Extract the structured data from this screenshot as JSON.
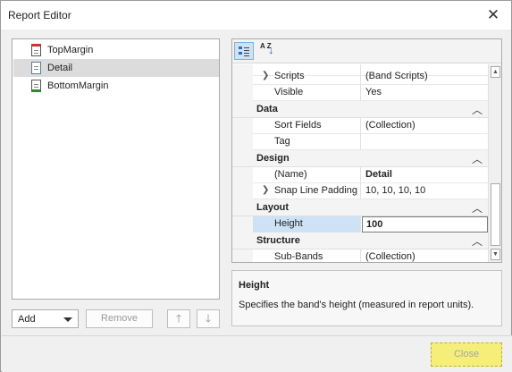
{
  "window": {
    "title": "Report Editor",
    "close_glyph": "✕"
  },
  "bands": [
    {
      "label": "TopMargin",
      "icon": "top-margin-band-icon"
    },
    {
      "label": "Detail",
      "icon": "detail-band-icon",
      "selected": true
    },
    {
      "label": "BottomMargin",
      "icon": "bottom-margin-band-icon"
    }
  ],
  "actions": {
    "add_label": "Add",
    "remove_label": "Remove",
    "up_glyph": "🡑",
    "down_glyph": "🡓"
  },
  "toolbar": {
    "categorized_icon": "categorized-icon",
    "alphabetical_icon": "sort-alphabetical-icon",
    "az_text": "A Z",
    "arrow_glyph": "↓"
  },
  "properties": {
    "rows": [
      {
        "kind": "prop",
        "name": "Scripts",
        "value": "(Band Scripts)",
        "expandable": true
      },
      {
        "kind": "prop",
        "name": "Visible",
        "value": "Yes"
      },
      {
        "kind": "cat",
        "name": "Data"
      },
      {
        "kind": "prop",
        "name": "Sort Fields",
        "value": "(Collection)"
      },
      {
        "kind": "prop",
        "name": "Tag",
        "value": ""
      },
      {
        "kind": "cat",
        "name": "Design"
      },
      {
        "kind": "prop",
        "name": "(Name)",
        "value": "Detail",
        "bold": true
      },
      {
        "kind": "prop",
        "name": "Snap Line Padding",
        "value": "10, 10, 10, 10",
        "expandable": true
      },
      {
        "kind": "cat",
        "name": "Layout"
      },
      {
        "kind": "prop",
        "name": "Height",
        "value": "100",
        "selected": true
      },
      {
        "kind": "cat",
        "name": "Structure"
      },
      {
        "kind": "prop",
        "name": "Sub-Bands",
        "value": "(Collection)"
      }
    ],
    "chevron_glyph": "︿",
    "expand_glyph": "❯"
  },
  "description": {
    "title": "Height",
    "text": "Specifies the band's height (measured in report units)."
  },
  "footer": {
    "close_label": "Close"
  },
  "colors": {
    "selection": "#cde3f5",
    "highlight": "#f5ef7a"
  }
}
